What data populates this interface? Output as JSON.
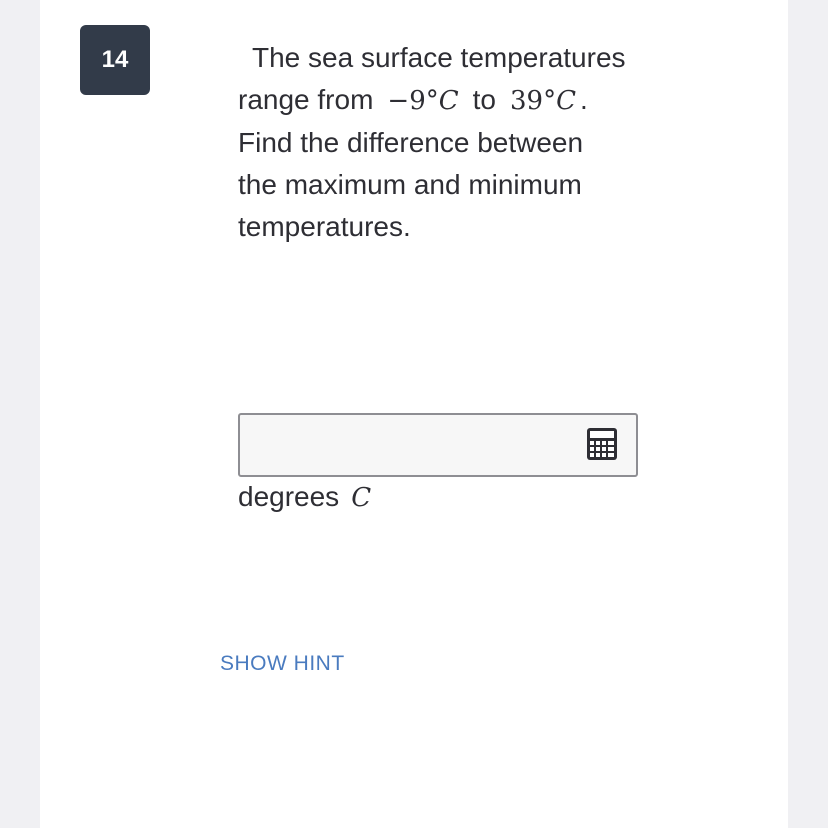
{
  "question": {
    "number": "14",
    "text_line1": "The sea surface temperatures",
    "range_prefix": "range from",
    "value_min": "−9°",
    "unit_min": "C",
    "connector": "to",
    "value_max": "39°",
    "unit_max": "C",
    "period": ".",
    "text_rest_1": "Find the difference between",
    "text_rest_2": "the maximum and minimum",
    "text_rest_3": "temperatures."
  },
  "answer": {
    "value": "",
    "units_label": "degrees",
    "units_var": "C"
  },
  "hint": {
    "label": "SHOW HINT"
  },
  "icons": {
    "calculator": "calculator-icon"
  },
  "colors": {
    "badge_bg": "#323b49",
    "hint_link": "#4a7bbf"
  }
}
